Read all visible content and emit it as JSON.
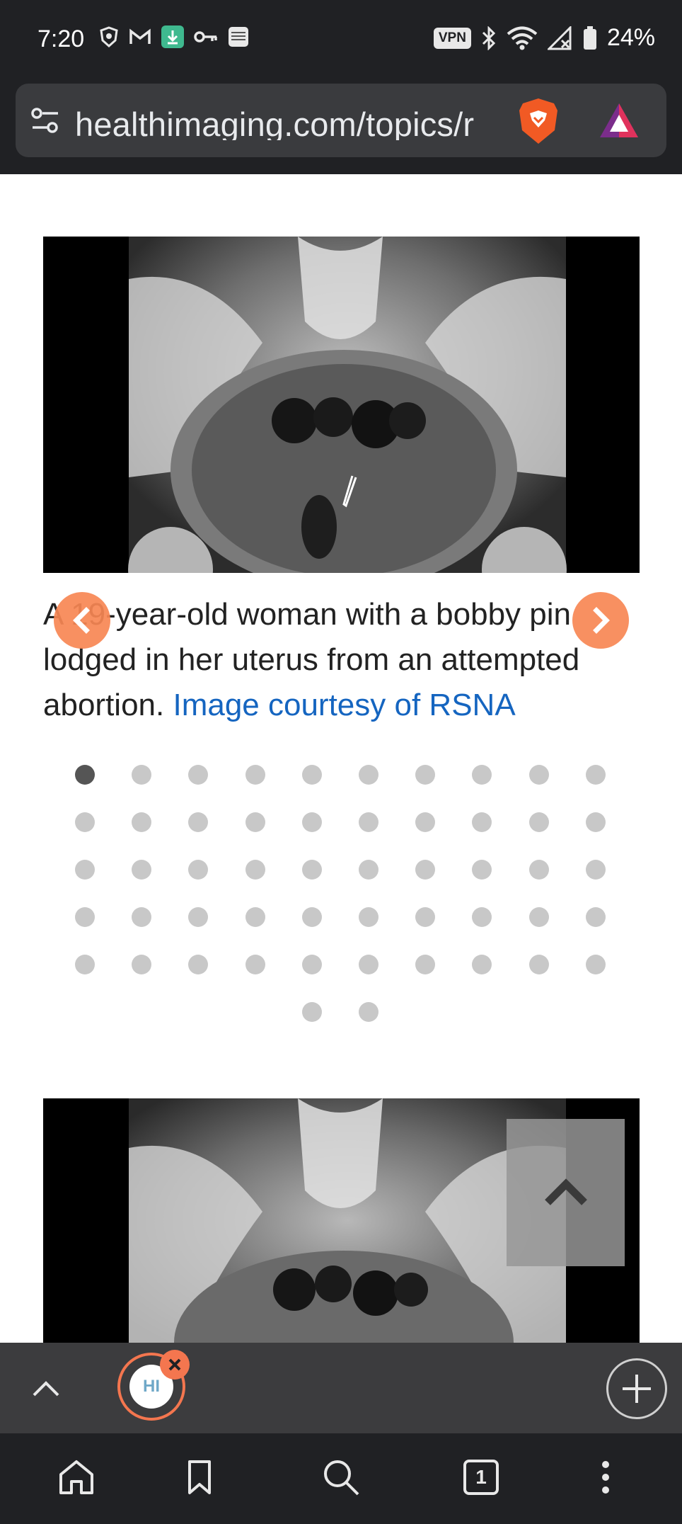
{
  "status_bar": {
    "time": "7:20",
    "left_icons": [
      "brave-shield-icon",
      "gmail-icon",
      "download-icon",
      "key-icon",
      "amazon-shopper-panel-icon"
    ],
    "vpn_label": "VPN",
    "right_icons": [
      "bluetooth-icon",
      "wifi-icon",
      "no-signal-icon",
      "battery-icon"
    ],
    "battery_percent": "24%"
  },
  "url_bar": {
    "url": "healthimaging.com/topics/r",
    "icons": [
      "site-settings-icon",
      "brave-shields-icon",
      "brave-rewards-icon"
    ]
  },
  "slideshow": {
    "caption_text": "A 19-year-old woman with a bobby pin lodged in her uterus from an attempted abortion. ",
    "caption_credit": "Image courtesy of RSNA",
    "active_slide": 1,
    "total_slides": 52
  },
  "tab_strip": {
    "tab_favicon_label": "HI"
  },
  "bottom_nav": {
    "tab_count": "1"
  },
  "colors": {
    "accent_orange": "#f4764f",
    "link_blue": "#1565c0",
    "dark_bg": "#202124",
    "dot_inactive": "#c8c8c8",
    "dot_active": "#555555"
  }
}
